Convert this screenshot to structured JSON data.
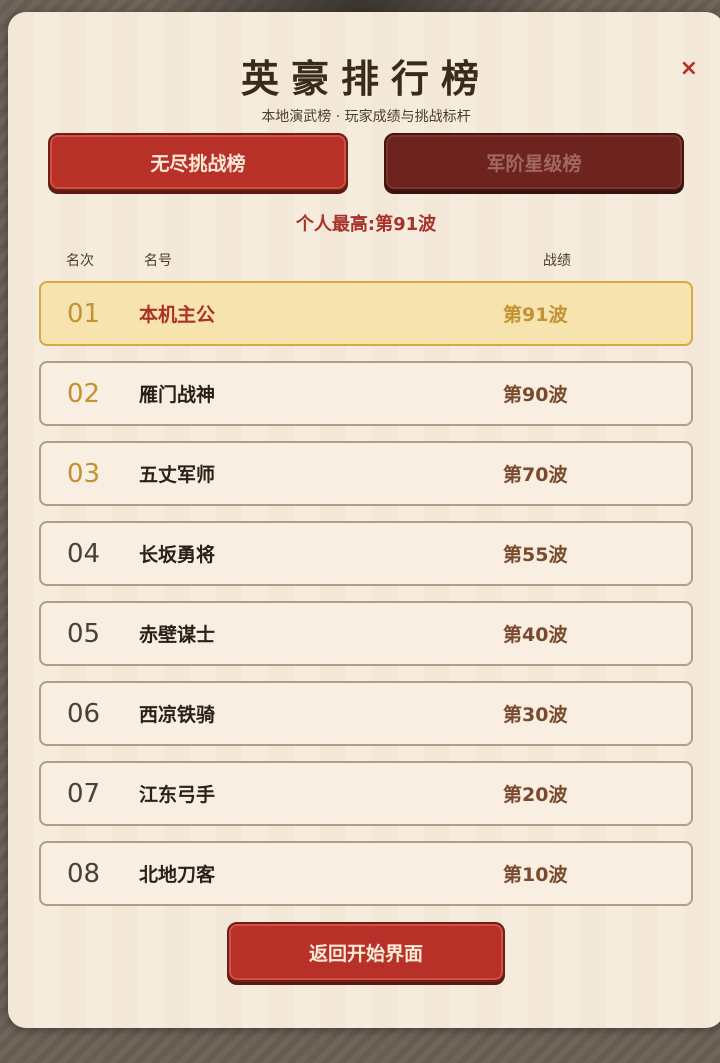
{
  "title": "英豪排行榜",
  "subtitle": "本地演武榜 · 玩家成绩与挑战标杆",
  "close_label": "×",
  "tabs": [
    {
      "label": "无尽挑战榜"
    },
    {
      "label": "军阶星级榜"
    }
  ],
  "personal_best": "个人最高:第91波",
  "headers": {
    "rank": "名次",
    "name": "名号",
    "score": "战绩"
  },
  "rows": [
    {
      "rank": "01",
      "name": "本机主公",
      "score": "第91波"
    },
    {
      "rank": "02",
      "name": "雁门战神",
      "score": "第90波"
    },
    {
      "rank": "03",
      "name": "五丈军师",
      "score": "第70波"
    },
    {
      "rank": "04",
      "name": "长坂勇将",
      "score": "第55波"
    },
    {
      "rank": "05",
      "name": "赤壁谋士",
      "score": "第40波"
    },
    {
      "rank": "06",
      "name": "西凉铁骑",
      "score": "第30波"
    },
    {
      "rank": "07",
      "name": "江东弓手",
      "score": "第20波"
    },
    {
      "rank": "08",
      "name": "北地刀客",
      "score": "第10波"
    }
  ],
  "back_button": "返回开始界面",
  "colors": {
    "accent_red": "#b83128",
    "gold": "#c29234",
    "highlight_row": "#f7e3ad",
    "panel": "#f6ecdd"
  }
}
